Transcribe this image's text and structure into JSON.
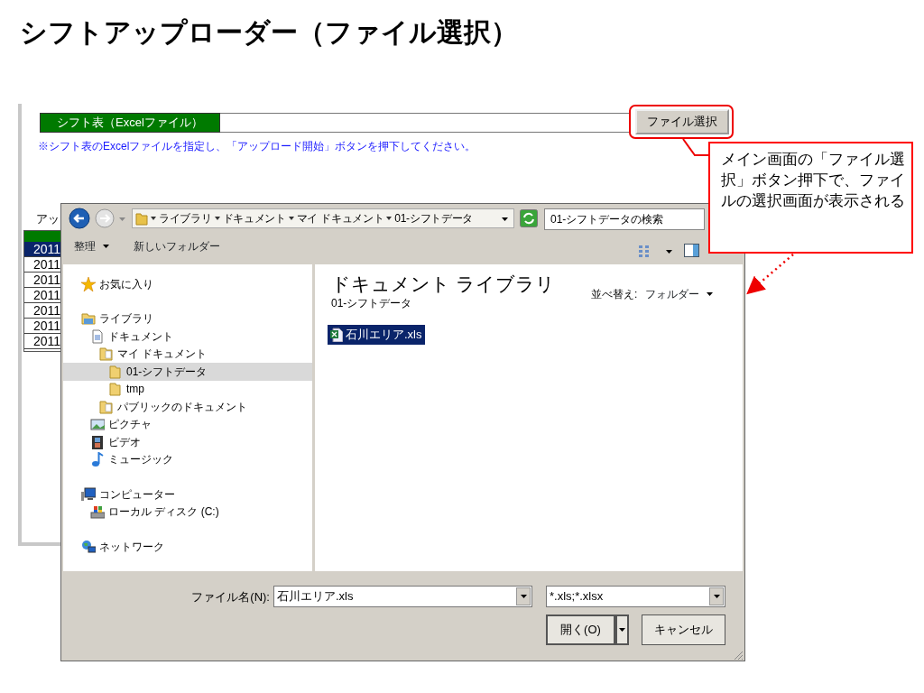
{
  "slide_title": "シフトアップローダー（ファイル選択）",
  "main_window": {
    "file_label": "シフト表（Excelファイル）",
    "select_button": "ファイル選択",
    "instruction": "※シフト表のExcelファイルを指定し、「アップロード開始」ボタンを押下してください。",
    "section_label": "アッ",
    "table_rows": [
      {
        "cell": "2011",
        "selected": true
      },
      {
        "cell": "2011",
        "selected": false
      },
      {
        "cell": "2011",
        "selected": false
      },
      {
        "cell": "2011",
        "selected": false
      },
      {
        "cell": "2011",
        "selected": false
      },
      {
        "cell": "2011",
        "selected": false
      },
      {
        "cell": "2011",
        "selected": false
      }
    ]
  },
  "file_dialog": {
    "breadcrumbs": [
      "ライブラリ",
      "ドキュメント",
      "マイ ドキュメント",
      "01-シフトデータ"
    ],
    "search": {
      "placeholder": "01-シフトデータの検索"
    },
    "toolbar": [
      {
        "label": "整理",
        "kind": "menu"
      },
      {
        "label": "新しいフォルダー",
        "kind": "plain"
      }
    ],
    "nav_tree": [
      {
        "label": "お気に入り",
        "kind": "favorites",
        "selected": false
      },
      {
        "label": "ライブラリ",
        "kind": "library",
        "selected": false,
        "children": [
          {
            "label": "ドキュメント",
            "kind": "documents",
            "selected": false,
            "children": [
              {
                "label": "マイ ドキュメント",
                "kind": "docfolder",
                "selected": false,
                "children": [
                  {
                    "label": "01-シフトデータ",
                    "kind": "folder",
                    "selected": true
                  },
                  {
                    "label": "tmp",
                    "kind": "folder",
                    "selected": false
                  }
                ]
              },
              {
                "label": "パブリックのドキュメント",
                "kind": "docfolder",
                "selected": false
              }
            ]
          },
          {
            "label": "ピクチャ",
            "kind": "pictures",
            "selected": false
          },
          {
            "label": "ビデオ",
            "kind": "videos",
            "selected": false
          },
          {
            "label": "ミュージック",
            "kind": "music",
            "selected": false
          }
        ]
      },
      {
        "label": "コンピューター",
        "kind": "computer",
        "selected": false,
        "children": [
          {
            "label": "ローカル ディスク (C:)",
            "kind": "disk",
            "selected": false
          }
        ]
      },
      {
        "label": "ネットワーク",
        "kind": "network",
        "selected": false
      }
    ],
    "heading": "ドキュメント ライブラリ",
    "subheading": "01-シフトデータ",
    "sort_label": "並べ替え:",
    "sort_value": "フォルダー",
    "files": [
      {
        "name": "石川エリア.xls",
        "selected": true
      }
    ],
    "filename_label": "ファイル名(N):",
    "filename_value": "石川エリア.xls",
    "filter_value": "*.xls;*.xlsx",
    "open_button": "開く(O)",
    "cancel_button": "キャンセル"
  },
  "callout": {
    "text": "メイン画面の「ファイル選択」ボタン押下で、ファイルの選択画面が表示される"
  }
}
